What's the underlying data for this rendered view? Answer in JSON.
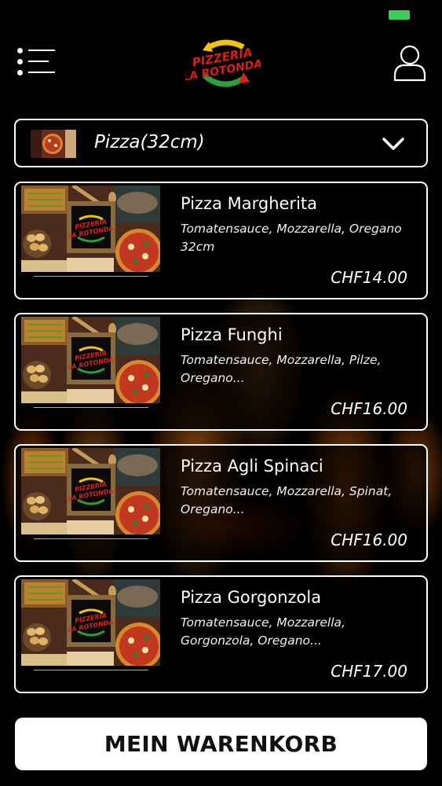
{
  "status_bar": {
    "battery_color": "#3ccc5c"
  },
  "header": {
    "menu_icon": "hamburger-menu-icon",
    "logo_text_line1": "PIZZERIA",
    "logo_text_line2": "LA ROTONDA",
    "user_icon": "user-icon"
  },
  "category": {
    "selected_label": "Pizza(32cm)",
    "dropdown_icon": "chevron-down-icon"
  },
  "products": [
    {
      "name": "Pizza Margherita",
      "description": "Tomatensauce, Mozzarella, Oregano 32cm",
      "price": "CHF14.00"
    },
    {
      "name": "Pizza Funghi",
      "description": "Tomatensauce, Mozzarella, Pilze, Oregano...",
      "price": "CHF16.00"
    },
    {
      "name": "Pizza Agli Spinaci",
      "description": "Tomatensauce, Mozzarella, Spinat, Oregano...",
      "price": "CHF16.00"
    },
    {
      "name": "Pizza Gorgonzola",
      "description": "Tomatensauce, Mozzarella, Gorgonzola, Oregano...",
      "price": "CHF17.00"
    }
  ],
  "cart": {
    "label": "MEIN WARENKORB"
  },
  "colors": {
    "background": "#000000",
    "accent_red": "#d8231f",
    "accent_yellow": "#f1c40f",
    "accent_green": "#2e9e3c"
  }
}
